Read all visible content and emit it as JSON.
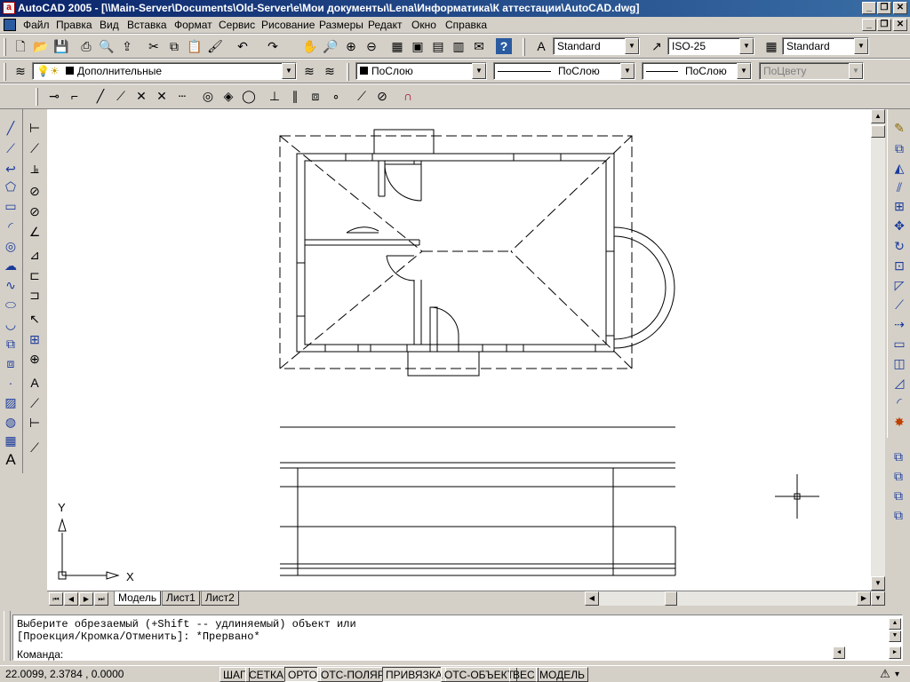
{
  "window": {
    "title": "AutoCAD 2005 - [\\\\Main-Server\\Documents\\Old-Server\\e\\Мои документы\\Lena\\Информатика\\К аттестации\\AutoCAD.dwg]",
    "app_icon": "autocad-logo-icon"
  },
  "menu": [
    "Файл",
    "Правка",
    "Вид",
    "Вставка",
    "Формат",
    "Сервис",
    "Рисование",
    "Размеры",
    "Редакт",
    "Окно",
    "Справка"
  ],
  "styles": {
    "text_style": "Standard",
    "dim_style": "ISO-25",
    "table_style": "Standard"
  },
  "layers": {
    "current_layer": "Дополнительные",
    "color": "ПоСлою",
    "linetype": "ПоСлою",
    "lineweight": "ПоСлою",
    "plotstyle": "ПоЦвету"
  },
  "layout_tabs": [
    "Модель",
    "Лист1",
    "Лист2"
  ],
  "active_tab": "Модель",
  "ucs": {
    "x_label": "X",
    "y_label": "Y"
  },
  "command": {
    "line1": "Выберите обрезаемый (+Shift -- удлиняемый) объект или",
    "line2": "[Проекция/Кромка/Отменить]: *Прервано*",
    "prompt": "Команда:"
  },
  "status": {
    "coordinates": "22.0099, 2.3784 , 0.0000",
    "toggles": [
      {
        "label": "ШАГ",
        "on": false
      },
      {
        "label": "СЕТКА",
        "on": false
      },
      {
        "label": "ОРТО",
        "on": true
      },
      {
        "label": "ОТС-ПОЛЯР",
        "on": false
      },
      {
        "label": "ПРИВЯЗКА",
        "on": true
      },
      {
        "label": "ОТС-ОБЪЕКТ",
        "on": false
      },
      {
        "label": "ВЕС",
        "on": false
      },
      {
        "label": "МОДЕЛЬ",
        "on": false
      }
    ]
  },
  "colors": {
    "titlebar": "#0a246a",
    "canvas": "#ffffff",
    "chrome": "#d4d0c8",
    "icon_blue": "#1a3a9a"
  }
}
